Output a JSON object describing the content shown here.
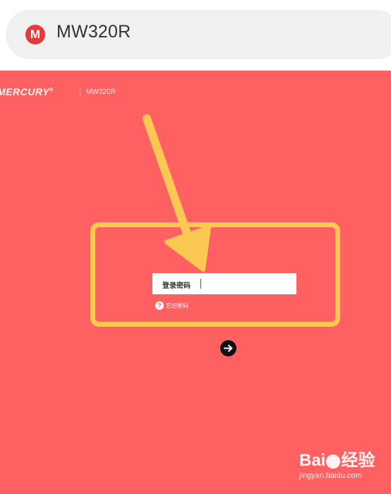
{
  "browser": {
    "site_icon_letter": "M",
    "address": "MW320R"
  },
  "router": {
    "brand": "MERCURY",
    "brand_mark": "®",
    "model": "MW320R",
    "password_label": "登录密码",
    "forgot_icon": "?",
    "forgot_text": "忘记密码",
    "login_icon": "arrow-right-icon"
  },
  "annotation": {
    "color": "#fbc852"
  },
  "watermark": {
    "brand_left": "Bai",
    "brand_right": "经验",
    "url": "jingyan.baidu.com"
  },
  "colors": {
    "page_background": "#ff6163",
    "highlight": "#fbc852",
    "address_bar": "#f0f0f0",
    "site_icon": "#e33b3b"
  }
}
